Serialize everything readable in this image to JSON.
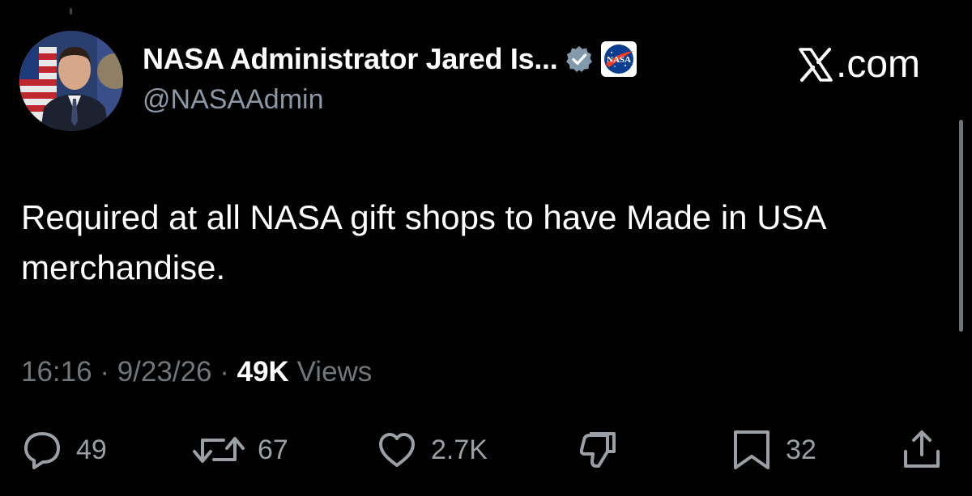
{
  "author": {
    "display_name": "NASA Administrator Jared Is...",
    "handle": "@NASAAdmin",
    "verified_badge_icon": "verified-check-icon",
    "agency_logo_icon": "nasa-logo-icon",
    "agency_logo_text": "NASA"
  },
  "brand": {
    "label": ".com",
    "icon": "x-logo-icon"
  },
  "post": {
    "text": "Required at all NASA gift shops to have Made in USA merchandise."
  },
  "meta": {
    "time": "16:16",
    "separator": "·",
    "date": "9/23/26",
    "views_count": "49K",
    "views_label": "Views"
  },
  "actions": {
    "replies": "49",
    "reposts": "67",
    "likes": "2.7K",
    "bookmarks": "32"
  },
  "colors": {
    "background": "#000000",
    "text": "#ffffff",
    "muted": "#71767b",
    "verified": "#829aab",
    "nasa_blue": "#0b3d91",
    "nasa_red": "#fc3d21"
  }
}
